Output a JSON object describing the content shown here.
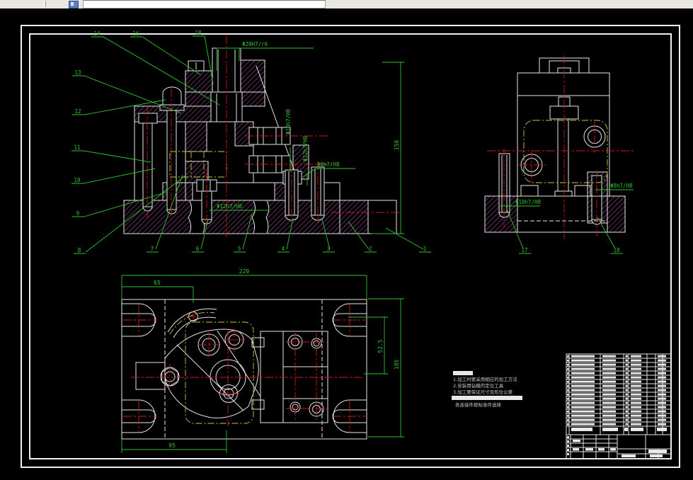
{
  "drawing": {
    "front": {
      "callouts": [
        "14",
        "16",
        "18",
        "13",
        "12",
        "11",
        "10",
        "9",
        "8",
        "7",
        "6",
        "5",
        "4",
        "3",
        "2",
        "1"
      ],
      "labels": {
        "fit_top": "Φ20H7/r6",
        "fit_vertical_1": "Φ18h7/H8",
        "fit_vertical_2": "Φ12h7/H8",
        "fit_bushing": "Φ8h7/H8",
        "fit_base": "Φ12h7/H8",
        "dim_height": "158"
      }
    },
    "side": {
      "callouts": [
        "17",
        "18"
      ],
      "labels": {
        "fit_pin_left": "Φ10h7/H8",
        "fit_pin_right": "Φ8h7/H8"
      }
    },
    "plan": {
      "dims": {
        "top_width": "220",
        "left_offset": "65",
        "right_inner": "52.5",
        "right_overall": "185",
        "bottom_offset": "95"
      }
    },
    "notes": {
      "lines": [
        "1.加工时要采用相应的加工方法",
        "2.安装用钻模的定位工具",
        "3.加工要保证尺寸及形位公差",
        "各连接件按标准件选择"
      ]
    }
  }
}
